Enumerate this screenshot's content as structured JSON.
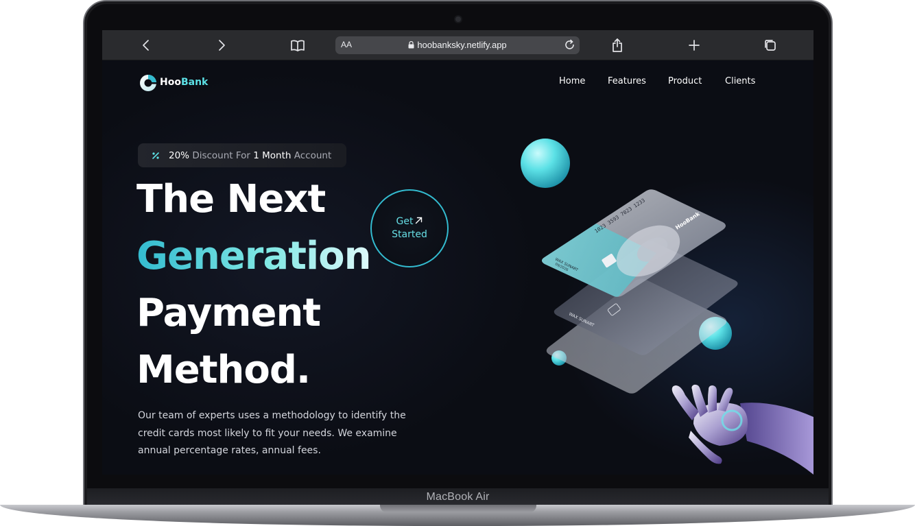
{
  "device": {
    "label": "MacBook Air"
  },
  "browser": {
    "text_size_button": "AA",
    "url": "hoobanksky.netlify.app"
  },
  "site": {
    "logo": {
      "part1": "Hoo",
      "part2": "Bank"
    },
    "nav": [
      {
        "label": "Home"
      },
      {
        "label": "Features"
      },
      {
        "label": "Product"
      },
      {
        "label": "Clients"
      }
    ],
    "discount": {
      "percent": "20%",
      "text1": "Discount For",
      "duration": "1 Month",
      "text2": "Account"
    },
    "hero": {
      "line1": "The Next",
      "line2": "Generation",
      "line3": "Payment",
      "line4": "Method."
    },
    "cta": {
      "line1": "Get",
      "line2": "Started"
    },
    "description": "Our team of experts uses a methodology to identify the credit cards most likely to fit your needs. We examine annual percentage rates, annual fees.",
    "card": {
      "number": "1023 3593 7023 1233",
      "holder": "WAX SUNART",
      "expiry": "09/2026",
      "brand": "HooBank"
    }
  },
  "colors": {
    "accent": "#5ce1e6",
    "accent_dark": "#33bbcf",
    "background": "#0b0d14"
  }
}
